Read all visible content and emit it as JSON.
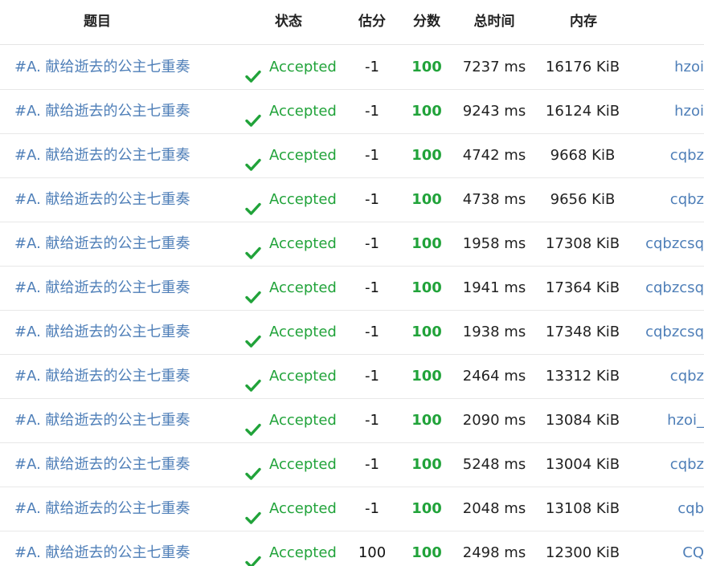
{
  "header": {
    "problem": "题目",
    "status": "状态",
    "estimate": "估分",
    "score": "分数",
    "time": "总时间",
    "memory": "内存"
  },
  "colors": {
    "accepted": "#21a33a",
    "link": "#4f7fb8"
  },
  "rows": [
    {
      "problem": "#A. 献给逝去的公主七重奏",
      "status": "Accepted",
      "estimate": "-1",
      "score": "100",
      "time": "7237 ms",
      "memory": "16176 KiB",
      "user": "hzoi"
    },
    {
      "problem": "#A. 献给逝去的公主七重奏",
      "status": "Accepted",
      "estimate": "-1",
      "score": "100",
      "time": "9243 ms",
      "memory": "16124 KiB",
      "user": "hzoi"
    },
    {
      "problem": "#A. 献给逝去的公主七重奏",
      "status": "Accepted",
      "estimate": "-1",
      "score": "100",
      "time": "4742 ms",
      "memory": "9668 KiB",
      "user": "cqbz"
    },
    {
      "problem": "#A. 献给逝去的公主七重奏",
      "status": "Accepted",
      "estimate": "-1",
      "score": "100",
      "time": "4738 ms",
      "memory": "9656 KiB",
      "user": "cqbz"
    },
    {
      "problem": "#A. 献给逝去的公主七重奏",
      "status": "Accepted",
      "estimate": "-1",
      "score": "100",
      "time": "1958 ms",
      "memory": "17308 KiB",
      "user": "cqbzcsq"
    },
    {
      "problem": "#A. 献给逝去的公主七重奏",
      "status": "Accepted",
      "estimate": "-1",
      "score": "100",
      "time": "1941 ms",
      "memory": "17364 KiB",
      "user": "cqbzcsq"
    },
    {
      "problem": "#A. 献给逝去的公主七重奏",
      "status": "Accepted",
      "estimate": "-1",
      "score": "100",
      "time": "1938 ms",
      "memory": "17348 KiB",
      "user": "cqbzcsq"
    },
    {
      "problem": "#A. 献给逝去的公主七重奏",
      "status": "Accepted",
      "estimate": "-1",
      "score": "100",
      "time": "2464 ms",
      "memory": "13312 KiB",
      "user": "cqbz"
    },
    {
      "problem": "#A. 献给逝去的公主七重奏",
      "status": "Accepted",
      "estimate": "-1",
      "score": "100",
      "time": "2090 ms",
      "memory": "13084 KiB",
      "user": "hzoi_"
    },
    {
      "problem": "#A. 献给逝去的公主七重奏",
      "status": "Accepted",
      "estimate": "-1",
      "score": "100",
      "time": "5248 ms",
      "memory": "13004 KiB",
      "user": "cqbz"
    },
    {
      "problem": "#A. 献给逝去的公主七重奏",
      "status": "Accepted",
      "estimate": "-1",
      "score": "100",
      "time": "2048 ms",
      "memory": "13108 KiB",
      "user": "cqb"
    },
    {
      "problem": "#A. 献给逝去的公主七重奏",
      "status": "Accepted",
      "estimate": "100",
      "score": "100",
      "time": "2498 ms",
      "memory": "12300 KiB",
      "user": "CQ"
    }
  ]
}
